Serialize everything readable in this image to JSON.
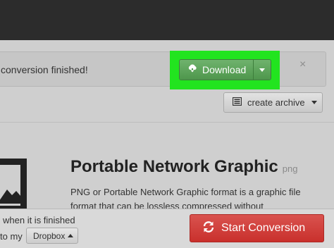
{
  "alert": {
    "text": "conversion finished!",
    "close_symbol": "×"
  },
  "download": {
    "label": "Download",
    "icon": "cloud-download-icon",
    "color": "#5cab59",
    "highlight_color": "#22e41f"
  },
  "archive": {
    "label": "create archive",
    "icon": "archive-icon"
  },
  "format": {
    "title": "Portable Network Graphic",
    "ext": "png",
    "description_line1": "PNG or Portable Network Graphic format is a graphic file",
    "description_line2": "format that can be  lossless compressed without  "
  },
  "footer": {
    "notify_line1": "when it is finished",
    "notify_line2": "to my",
    "dropbox_label": "Dropbox",
    "start_label": "Start Conversion",
    "start_icon": "refresh-icon",
    "start_color": "#d24b47"
  }
}
